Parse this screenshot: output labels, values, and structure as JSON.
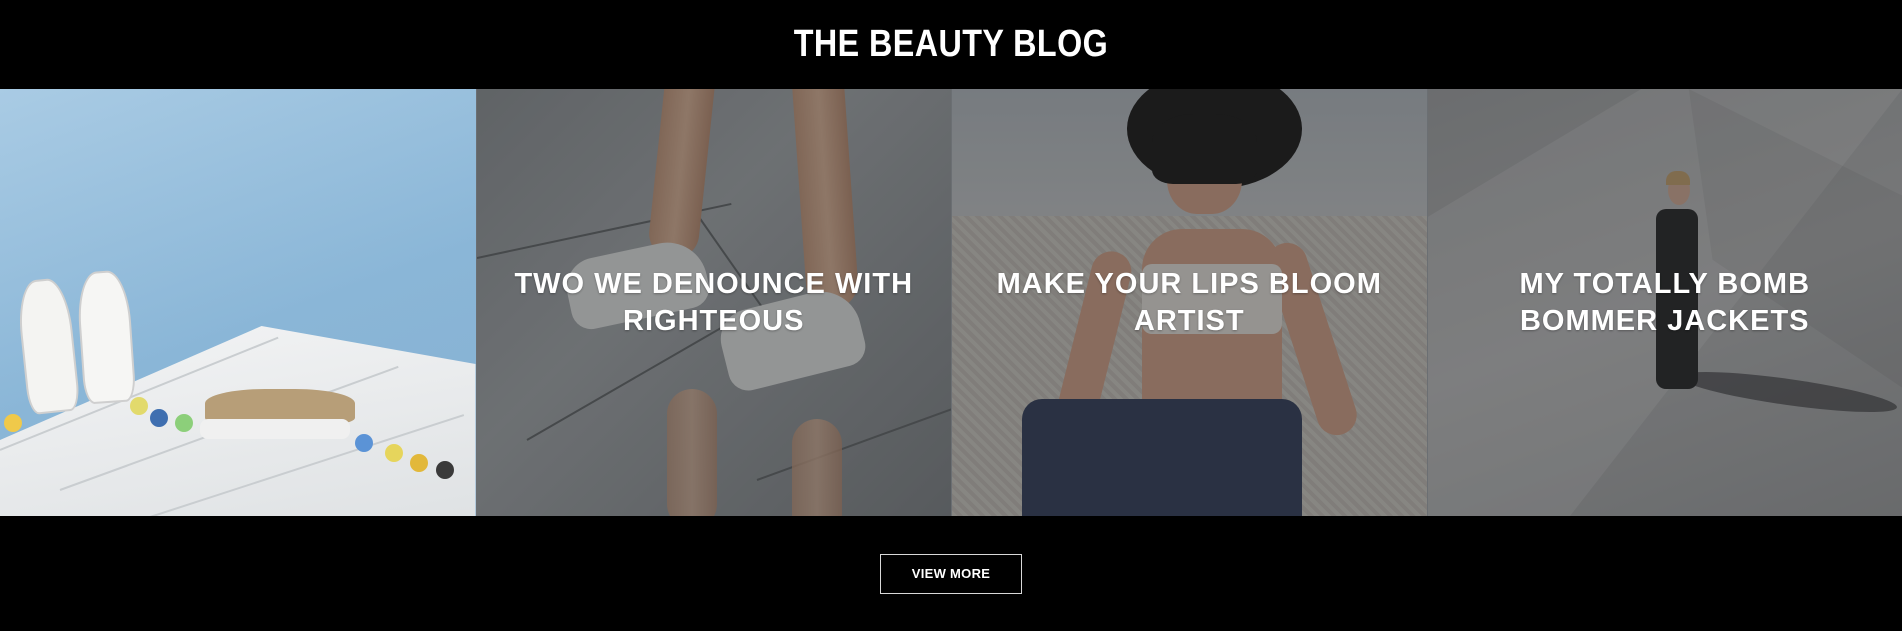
{
  "header": {
    "title": "THE BEAUTY BLOG"
  },
  "posts": [
    {
      "title": ""
    },
    {
      "title": "TWO WE DENOUNCE WITH RIGHTEOUS"
    },
    {
      "title": "MAKE YOUR LIPS BLOOM ARTIST"
    },
    {
      "title": "MY TOTALLY BOMB BOMMER JACKETS"
    }
  ],
  "footer": {
    "view_more_label": "VIEW MORE"
  },
  "colors": {
    "background": "#000000",
    "text": "#ffffff",
    "overlay": "rgba(40,40,40,0.45)"
  }
}
